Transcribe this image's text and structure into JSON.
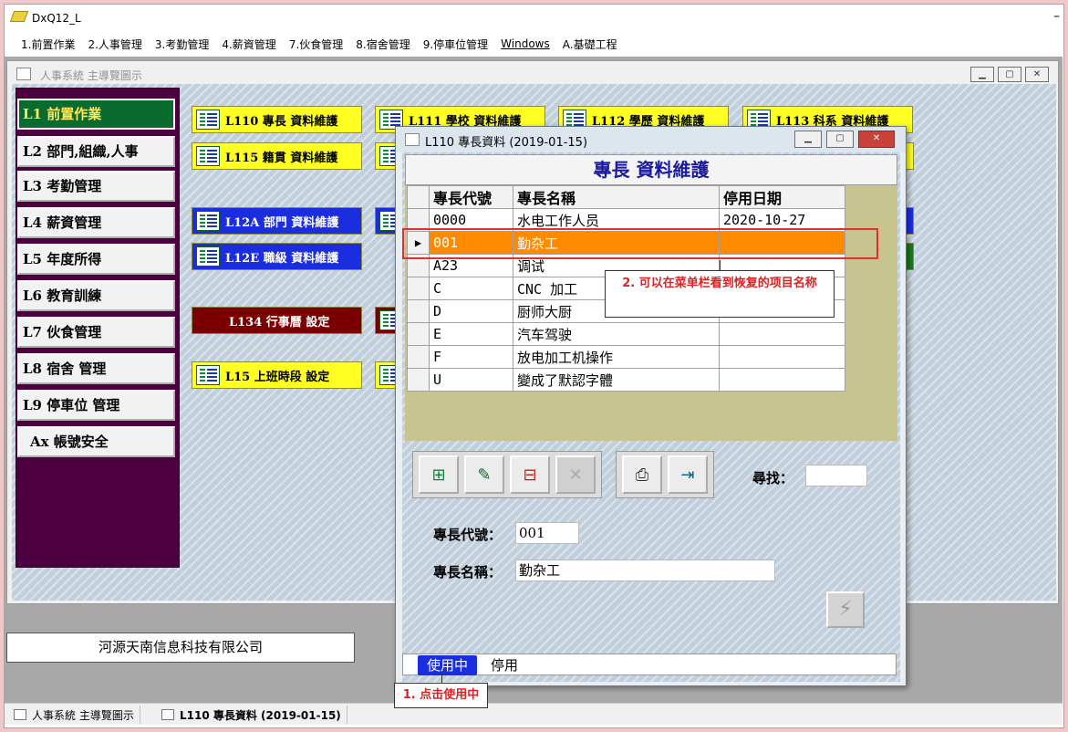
{
  "app": {
    "title": "DxQ12_L"
  },
  "menu": [
    "1.前置作業",
    "2.人事管理",
    "3.考勤管理",
    "4.薪資管理",
    "7.伙食管理",
    "8.宿舍管理",
    "9.停車位管理",
    "Windows",
    "A.基礎工程"
  ],
  "subwindow": {
    "title": "人事系統 主導覽圖示"
  },
  "nav": [
    "L1 前置作業",
    "L2 部門,組織,人事",
    "L3 考勤管理",
    "L4 薪資管理",
    "L5 年度所得",
    "L6 教育訓練",
    "L7 伙食管理",
    "L8 宿舍 管理",
    "L9 停車位 管理",
    "Ax 帳號安全"
  ],
  "tiles": {
    "t1": "L110 專長 資料維護",
    "t2": "L111 學校 資料維護",
    "t3": "L112 學歷 資料維護",
    "t4": "L113 科系 資料維護",
    "t5": "L115 籍貫 資料維護",
    "t6": "L12A 部門 資料維護",
    "t7": "L12E 職級 資料維護",
    "t8": "L134 行事曆 設定",
    "t9": "L15 上班時段 設定"
  },
  "company": "河源天南信息科技有限公司",
  "taskbar": [
    "人事系統 主導覽圖示",
    "L110 專長資料 (2019-01-15)"
  ],
  "dialog": {
    "title": "L110 專長資料 (2019-01-15)",
    "header": "專長 資料維護",
    "columns": [
      "專長代號",
      "專長名稱",
      "停用日期"
    ],
    "rows": [
      [
        "0000",
        "水电工作人员",
        "2020-10-27"
      ],
      [
        "001",
        "勤杂工",
        ""
      ],
      [
        "A23",
        "调试",
        ""
      ],
      [
        "C",
        "CNC 加工",
        ""
      ],
      [
        "D",
        "厨师大厨",
        ""
      ],
      [
        "E",
        "汽车驾驶",
        ""
      ],
      [
        "F",
        "放电加工机操作",
        ""
      ],
      [
        "U",
        "變成了默認字體",
        ""
      ]
    ],
    "search_label": "尋找：",
    "search_value": "",
    "code_label": "專長代號：",
    "code_value": "001",
    "name_label": "專長名稱：",
    "name_value": "勤杂工",
    "tabs": [
      "使用中",
      "停用"
    ]
  },
  "annotations": {
    "note1": "1. 点击使用中",
    "note2": "2. 可以在菜单栏看到恢复的项目名称"
  },
  "colors": {
    "nav_bg": "#4c0040",
    "active_nav": "#0a6b2e",
    "selected_row": "#ff8a00",
    "annotation_red": "#e02020"
  }
}
